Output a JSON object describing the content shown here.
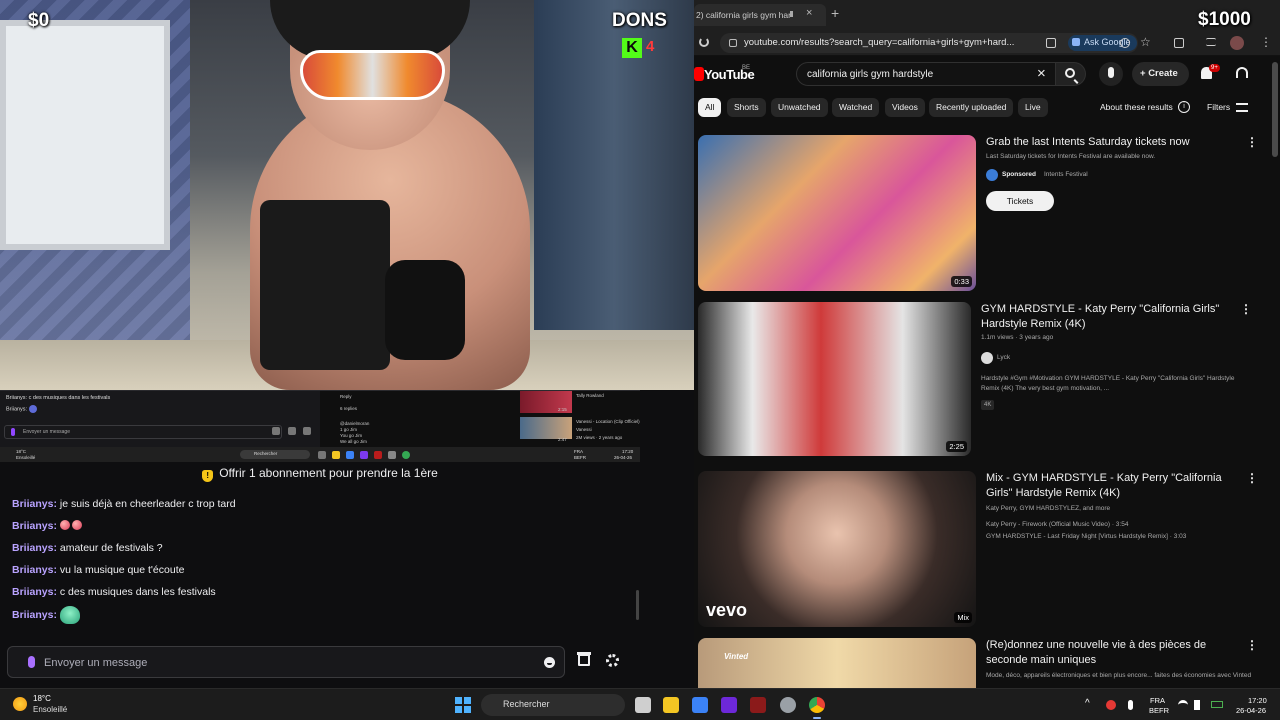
{
  "overlay": {
    "donations_left": "$0",
    "dons_label": "DONS",
    "donations_goal": "$1000",
    "kick_letter": "K",
    "kick_count": "4"
  },
  "mini_capture": {
    "chat_line_1": "Briianys: c des musiques dans les festivals",
    "chat_line_2": "Briianys:",
    "input_placeholder": "Envoyer un message",
    "replies": "6 replies",
    "reply_label": "Reply",
    "comment_user": "@danielmoran",
    "comment_lines": [
      "1 go Jim",
      "You go Jim",
      "We all go Jim"
    ],
    "video_1_title": "Tally Rowland",
    "video_2_title": "Vanessi - Location (Clip Officiel)",
    "video_2_channel": "Vanessi",
    "video_2_meta": "2M views · 2 years ago",
    "duration_1": "2:15",
    "duration_2": "2:47",
    "taskbar_temp": "18°C",
    "taskbar_weather": "Ensoleillé",
    "taskbar_search": "Rechercher",
    "taskbar_lang": "FRA",
    "taskbar_layout": "BEFR",
    "taskbar_time": "17:20",
    "taskbar_date": "26-04-26"
  },
  "chat": {
    "sub_banner": "Offrir 1 abonnement pour prendre la 1ère",
    "messages": [
      {
        "user": "Briianys",
        "text": "je suis déjà en cheerleader c trop tard"
      },
      {
        "user": "Briianys",
        "text": ""
      },
      {
        "user": "Briianys",
        "text": "amateur de festivals ?"
      },
      {
        "user": "Briianys",
        "text": "vu la musique que t'écoute"
      },
      {
        "user": "Briianys",
        "text": "c des musiques dans les festivals"
      },
      {
        "user": "Briianys",
        "text": ""
      }
    ],
    "separator": ":",
    "input_placeholder": "Envoyer un message"
  },
  "browser": {
    "tab_title": "2) california girls gym har",
    "url": "youtube.com/results?search_query=california+girls+gym+hard...",
    "ask_google": "Ask Google"
  },
  "youtube": {
    "logo": "YouTube",
    "country": "BE",
    "search_value": "california girls gym hardstyle",
    "create_label": "Create",
    "notif_badge": "9+",
    "chips": [
      "All",
      "Shorts",
      "Unwatched",
      "Watched",
      "Videos",
      "Recently uploaded",
      "Live"
    ],
    "about_results": "About these results",
    "filters": "Filters",
    "results": [
      {
        "title": "Grab the last Intents Saturday tickets now",
        "desc": "Last Saturday tickets for Intents Festival are available now.",
        "sponsored": "Sponsored",
        "advertiser": "Intents Festival",
        "cta": "Tickets",
        "duration": "0:33"
      },
      {
        "title": "GYM HARDSTYLE - Katy Perry \"California Girls\" Hardstyle Remix (4K)",
        "meta": "1.1m views · 3 years ago",
        "channel": "Lyck",
        "desc": "Hardstyle #Gym #Motivation GYM HARDSTYLE - Katy Perry \"California Girls\" Hardstyle Remix (4K) The very best gym motivation, ...",
        "tag": "4K",
        "duration": "2:25"
      },
      {
        "title": "Mix - GYM HARDSTYLE - Katy Perry \"California Girls\" Hardstyle Remix (4K)",
        "meta": "Katy Perry, GYM HARDSTYLEZ, and more",
        "track_1": "Katy Perry - Firework (Official Music Video) · 3:54",
        "track_2": "GYM HARDSTYLE - Last Friday Night [Virtus Hardstyle Remix] · 3:03",
        "badge": "vevo",
        "duration": "Mix"
      },
      {
        "title": "(Re)donnez une nouvelle vie à des pièces de seconde main uniques",
        "desc": "Mode, déco, appareils électroniques et bien plus encore... faites des économies avec Vinted",
        "brand": "Vinted"
      }
    ]
  },
  "taskbar": {
    "temp": "18°C",
    "weather": "Ensoleillé",
    "search": "Rechercher",
    "lang": "FRA",
    "layout": "BEFR",
    "time": "17:20",
    "date": "26-04-26"
  },
  "colors": {
    "twitch_purple": "#9147ff",
    "chat_username": "#b9a3ff",
    "youtube_red": "#ff0000",
    "kick_green": "#53fc18"
  }
}
